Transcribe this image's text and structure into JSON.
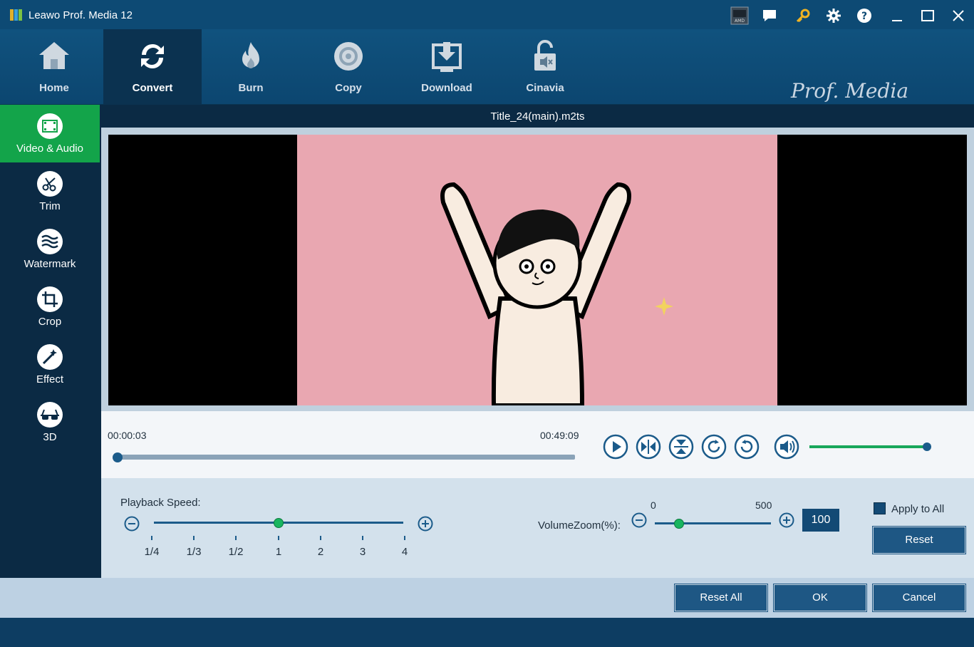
{
  "app": {
    "title": "Leawo Prof. Media 12"
  },
  "titlebar_icons": [
    "amd-icon",
    "feedback-icon",
    "key-icon",
    "settings-icon",
    "help-icon",
    "minimize-icon",
    "maximize-icon",
    "close-icon"
  ],
  "nav": {
    "items": [
      {
        "label": "Home",
        "icon": "home-icon"
      },
      {
        "label": "Convert",
        "icon": "convert-icon",
        "active": true
      },
      {
        "label": "Burn",
        "icon": "burn-icon"
      },
      {
        "label": "Copy",
        "icon": "copy-icon"
      },
      {
        "label": "Download",
        "icon": "download-icon"
      },
      {
        "label": "Cinavia",
        "icon": "cinavia-icon"
      }
    ],
    "brand": "Prof. Media"
  },
  "sidebar": {
    "items": [
      {
        "label": "Video & Audio",
        "icon": "film-icon",
        "active": true
      },
      {
        "label": "Trim",
        "icon": "scissors-icon"
      },
      {
        "label": "Watermark",
        "icon": "watermark-icon"
      },
      {
        "label": "Crop",
        "icon": "crop-icon"
      },
      {
        "label": "Effect",
        "icon": "magic-wand-icon"
      },
      {
        "label": "3D",
        "icon": "3d-glasses-icon"
      }
    ]
  },
  "file": {
    "name": "Title_24(main).m2ts"
  },
  "player": {
    "current_time": "00:00:03",
    "total_time": "00:49:09",
    "seek_fraction": 0.0,
    "volume_fraction": 1.0
  },
  "settings": {
    "speed_label": "Playback Speed:",
    "speed_ticks": [
      "1/4",
      "1/3",
      "1/2",
      "1",
      "2",
      "3",
      "4"
    ],
    "speed_selected": "1",
    "volume_zoom_label": "VolumeZoom(%):",
    "volume_zoom_min": "0",
    "volume_zoom_max": "500",
    "volume_zoom_value": "100",
    "apply_to_all_label": "Apply to All",
    "apply_to_all_checked": false,
    "reset_label": "Reset"
  },
  "footer": {
    "reset_all_label": "Reset All",
    "ok_label": "OK",
    "cancel_label": "Cancel"
  },
  "colors": {
    "accent_green": "#13a44a",
    "nav_blue": "#10527e",
    "button_blue": "#1e5784"
  }
}
